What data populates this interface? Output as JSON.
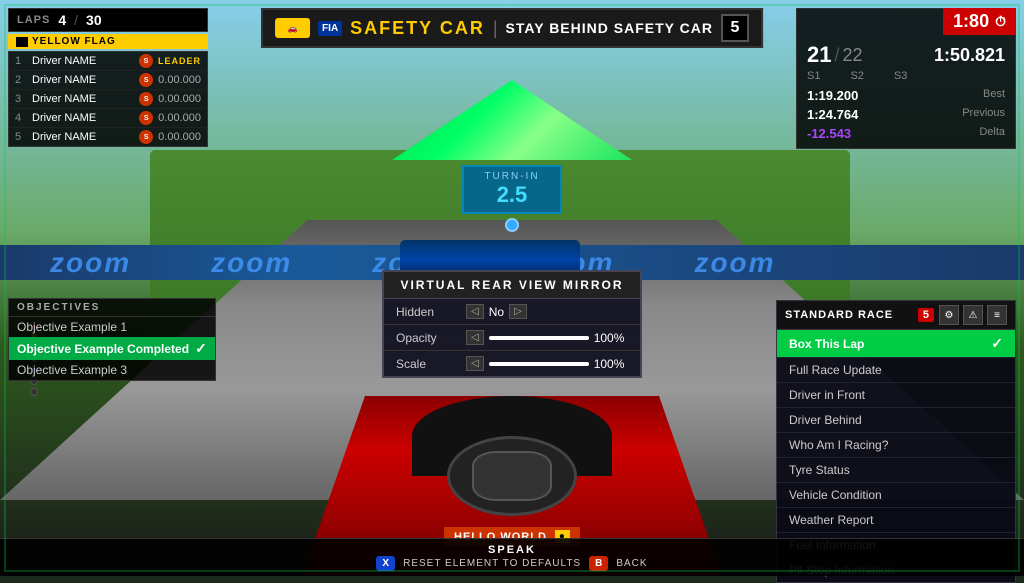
{
  "header": {
    "timer": "1:80",
    "safety_car_label": "SAFETY CAR",
    "stay_behind": "STAY BEHIND SAFETY CAR",
    "lap_count_badge": "5",
    "fia_text": "FIA"
  },
  "laps": {
    "label": "LAPS",
    "current": "4",
    "total": "30"
  },
  "flag": {
    "label": "YELLOW FLAG"
  },
  "positions": [
    {
      "num": "1",
      "name": "Driver NAME",
      "extra": "LEADER"
    },
    {
      "num": "2",
      "name": "Driver NAME",
      "time": "0.00.000"
    },
    {
      "num": "3",
      "name": "Driver NAME",
      "time": "0.00.000"
    },
    {
      "num": "4",
      "name": "Driver NAME",
      "time": "0.00.000"
    },
    {
      "num": "5",
      "name": "Driver NAME",
      "time": "0.00.000"
    }
  ],
  "timing": {
    "position": "21",
    "position_total": "22",
    "lap_time": "1:50.821",
    "s1": "S1",
    "s2": "S2",
    "s3": "S3",
    "best_time": "1:19.200",
    "best_label": "Best",
    "previous_time": "1:24.764",
    "previous_label": "Previous",
    "delta_time": "-12.543",
    "delta_label": "Delta"
  },
  "turnin": {
    "label": "TURN-IN",
    "value": "2.5"
  },
  "objectives": {
    "header": "OBJECTIVES",
    "items": [
      {
        "label": "Objective Example 1",
        "completed": false
      },
      {
        "label": "Objective Example Completed",
        "completed": true
      },
      {
        "label": "Objective Example 3",
        "completed": false
      }
    ]
  },
  "mirror_modal": {
    "title": "VIRTUAL REAR VIEW MIRROR",
    "hidden_label": "Hidden",
    "hidden_value": "No",
    "opacity_label": "Opacity",
    "opacity_value": "100%",
    "scale_label": "Scale",
    "scale_value": "100%"
  },
  "mfd": {
    "title": "STANDARD RACE",
    "badge": "5",
    "items": [
      {
        "label": "Box This Lap",
        "active": true
      },
      {
        "label": "Full Race Update",
        "active": false
      },
      {
        "label": "Driver in Front",
        "active": false
      },
      {
        "label": "Driver Behind",
        "active": false
      },
      {
        "label": "Who Am I Racing?",
        "active": false
      },
      {
        "label": "Tyre Status",
        "active": false
      },
      {
        "label": "Vehicle Condition",
        "active": false
      },
      {
        "label": "Weather Report",
        "active": false
      },
      {
        "label": "Fuel Information",
        "active": false
      },
      {
        "label": "Pit Stop Information",
        "active": false
      }
    ]
  },
  "bottom": {
    "speak_label": "SPEAK",
    "reset_label": "RESET ELEMENT TO DEFAULTS",
    "back_label": "BACK",
    "hello_text": "HELLO WORLD"
  },
  "zoom_texts": [
    "zoom",
    "zoom",
    "zoom",
    "zoom",
    "zoom"
  ]
}
